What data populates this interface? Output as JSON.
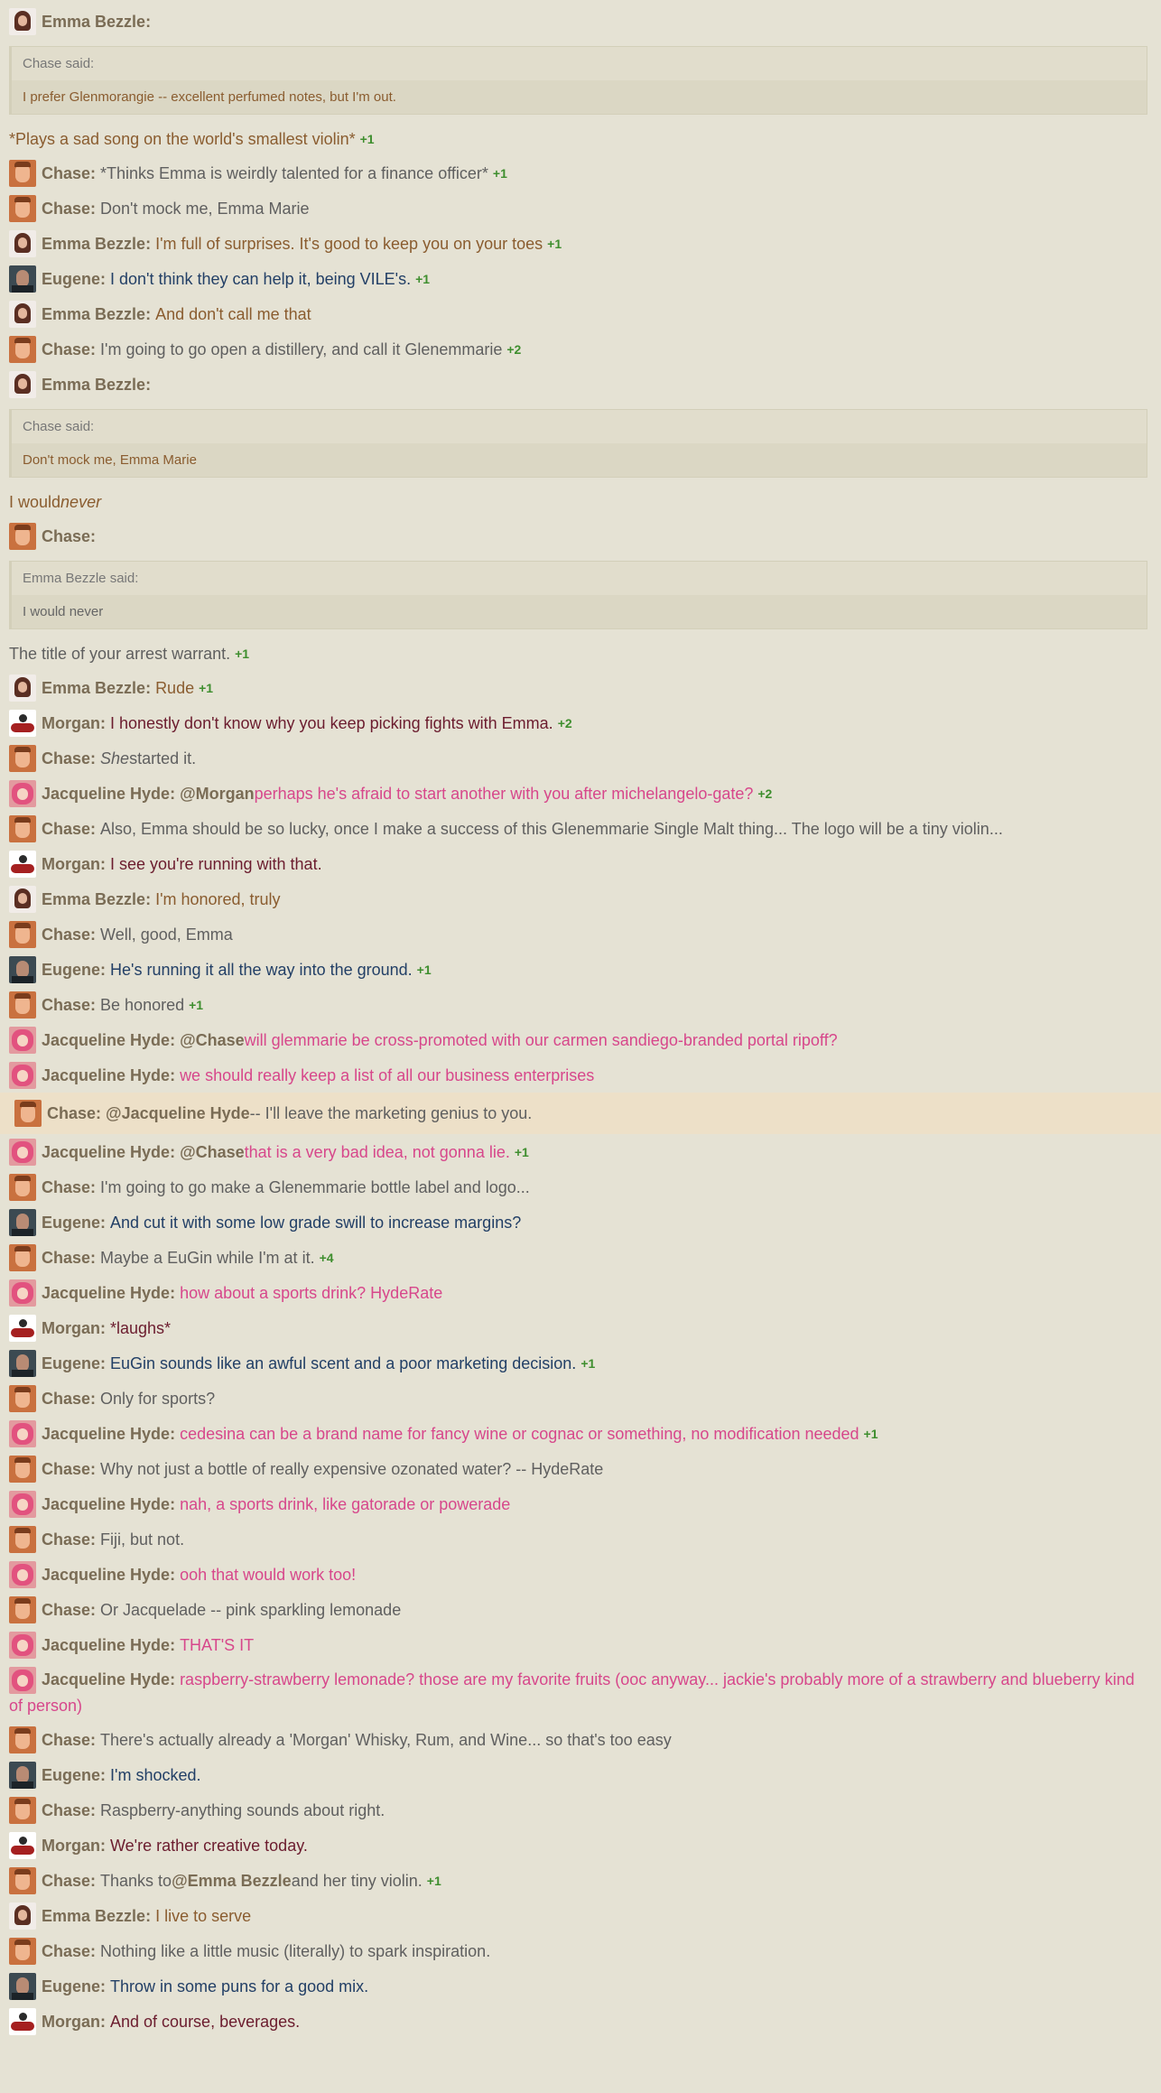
{
  "plus_prefix": "+",
  "messages": [
    {
      "kind": "msg",
      "author": "Emma Bezzle",
      "avatar": "emma",
      "parts": [],
      "plus": null,
      "quote": {
        "head": "Chase said:",
        "body": "I prefer Glenmorangie -- excellent perfumed notes, but I'm out."
      },
      "after": [
        {
          "t": "*Plays a sad song on the world's smallest violin*",
          "s": "emma"
        }
      ],
      "after_plus": "1"
    },
    {
      "kind": "msg",
      "author": "Chase",
      "avatar": "chase",
      "parts": [
        {
          "t": "*Thinks Emma is weirdly talented for a finance officer*",
          "s": "chase"
        }
      ],
      "plus": "1"
    },
    {
      "kind": "msg",
      "author": "Chase",
      "avatar": "chase",
      "parts": [
        {
          "t": "Don't mock me, Emma Marie",
          "s": "chase"
        }
      ],
      "plus": null
    },
    {
      "kind": "msg",
      "author": "Emma Bezzle",
      "avatar": "emma",
      "parts": [
        {
          "t": "I'm full of surprises. It's good to keep you on your toes",
          "s": "emma"
        }
      ],
      "plus": "1"
    },
    {
      "kind": "msg",
      "author": "Eugene",
      "avatar": "eugene",
      "parts": [
        {
          "t": "I don't think they can help it, being VILE's.",
          "s": "eugene"
        }
      ],
      "plus": "1"
    },
    {
      "kind": "msg",
      "author": "Emma Bezzle",
      "avatar": "emma",
      "parts": [
        {
          "t": "And don't call me that",
          "s": "emma"
        }
      ],
      "plus": null
    },
    {
      "kind": "msg",
      "author": "Chase",
      "avatar": "chase",
      "parts": [
        {
          "t": "I'm going to go open a distillery, and call it Glenemmarie",
          "s": "chase"
        }
      ],
      "plus": "2"
    },
    {
      "kind": "msg",
      "author": "Emma Bezzle",
      "avatar": "emma",
      "parts": [],
      "plus": null,
      "quote": {
        "head": "Chase said:",
        "body": "Don't mock me, Emma Marie"
      },
      "after": [
        {
          "t": "I would ",
          "s": "emma"
        },
        {
          "t": "never",
          "s": "emma",
          "i": true
        }
      ],
      "after_plus": null
    },
    {
      "kind": "msg",
      "author": "Chase",
      "avatar": "chase",
      "parts": [],
      "plus": null,
      "quote": {
        "head": "Emma Bezzle said:",
        "body": "I would never"
      },
      "after": [
        {
          "t": "The title of your arrest warrant.",
          "s": "chase"
        }
      ],
      "after_plus": "1"
    },
    {
      "kind": "msg",
      "author": "Emma Bezzle",
      "avatar": "emma",
      "parts": [
        {
          "t": "Rude",
          "s": "emma"
        }
      ],
      "plus": "1"
    },
    {
      "kind": "msg",
      "author": "Morgan",
      "avatar": "morgan",
      "parts": [
        {
          "t": "I honestly don't know why you keep picking fights with Emma.",
          "s": "morgan"
        }
      ],
      "plus": "2"
    },
    {
      "kind": "msg",
      "author": "Chase",
      "avatar": "chase",
      "parts": [
        {
          "t": "She",
          "s": "chase",
          "i": true
        },
        {
          "t": " started it.",
          "s": "chase"
        }
      ],
      "plus": null
    },
    {
      "kind": "msg",
      "author": "Jacqueline Hyde",
      "avatar": "jackie",
      "parts": [
        {
          "t": "@Morgan",
          "s": "mention"
        },
        {
          "t": " perhaps he's afraid to start another with you after michelangelo-gate?",
          "s": "jackie"
        }
      ],
      "plus": "2"
    },
    {
      "kind": "msg",
      "author": "Chase",
      "avatar": "chase",
      "parts": [
        {
          "t": "Also, Emma should be so lucky, once I make a success of this Glenemmarie Single Malt thing... The logo will be a tiny violin...",
          "s": "chase"
        }
      ],
      "plus": null
    },
    {
      "kind": "msg",
      "author": "Morgan",
      "avatar": "morgan",
      "parts": [
        {
          "t": "I see you're running with that.",
          "s": "morgan"
        }
      ],
      "plus": null
    },
    {
      "kind": "msg",
      "author": "Emma Bezzle",
      "avatar": "emma",
      "parts": [
        {
          "t": "I'm honored, truly",
          "s": "emma"
        }
      ],
      "plus": null
    },
    {
      "kind": "msg",
      "author": "Chase",
      "avatar": "chase",
      "parts": [
        {
          "t": "Well, good, Emma",
          "s": "chase"
        }
      ],
      "plus": null
    },
    {
      "kind": "msg",
      "author": "Eugene",
      "avatar": "eugene",
      "parts": [
        {
          "t": "He's running it all the way into the ground.",
          "s": "eugene"
        }
      ],
      "plus": "1"
    },
    {
      "kind": "msg",
      "author": "Chase",
      "avatar": "chase",
      "parts": [
        {
          "t": "Be honored",
          "s": "chase"
        }
      ],
      "plus": "1"
    },
    {
      "kind": "msg",
      "author": "Jacqueline Hyde",
      "avatar": "jackie",
      "parts": [
        {
          "t": "@Chase",
          "s": "mention"
        },
        {
          "t": " will glemmarie be cross-promoted with our carmen sandiego-branded portal ripoff?",
          "s": "jackie"
        }
      ],
      "plus": null
    },
    {
      "kind": "msg",
      "author": "Jacqueline Hyde",
      "avatar": "jackie",
      "parts": [
        {
          "t": "we should really keep a list of all our business enterprises",
          "s": "jackie"
        }
      ],
      "plus": null
    },
    {
      "kind": "msg",
      "highlight": true,
      "author": "Chase",
      "avatar": "chase",
      "parts": [
        {
          "t": "@Jacqueline Hyde",
          "s": "mention"
        },
        {
          "t": " -- I'll leave the marketing genius to you.",
          "s": "chase"
        }
      ],
      "plus": null
    },
    {
      "kind": "msg",
      "author": "Jacqueline Hyde",
      "avatar": "jackie",
      "parts": [
        {
          "t": "@Chase",
          "s": "mention"
        },
        {
          "t": " that is a very bad idea, not gonna lie.",
          "s": "jackie"
        }
      ],
      "plus": "1"
    },
    {
      "kind": "msg",
      "author": "Chase",
      "avatar": "chase",
      "parts": [
        {
          "t": "I'm going to go make a Glenemmarie bottle label and logo...",
          "s": "chase"
        }
      ],
      "plus": null
    },
    {
      "kind": "msg",
      "author": "Eugene",
      "avatar": "eugene",
      "parts": [
        {
          "t": "And cut it with some low grade swill to increase margins?",
          "s": "eugene"
        }
      ],
      "plus": null
    },
    {
      "kind": "msg",
      "author": "Chase",
      "avatar": "chase",
      "parts": [
        {
          "t": "Maybe a EuGin while I'm at it.",
          "s": "chase"
        }
      ],
      "plus": "4"
    },
    {
      "kind": "msg",
      "author": "Jacqueline Hyde",
      "avatar": "jackie",
      "parts": [
        {
          "t": "how about a sports drink? HydeRate",
          "s": "jackie"
        }
      ],
      "plus": null
    },
    {
      "kind": "msg",
      "author": "Morgan",
      "avatar": "morgan",
      "parts": [
        {
          "t": "*laughs*",
          "s": "morgan"
        }
      ],
      "plus": null
    },
    {
      "kind": "msg",
      "author": "Eugene",
      "avatar": "eugene",
      "parts": [
        {
          "t": "EuGin sounds like an awful scent and a poor marketing decision.",
          "s": "eugene"
        }
      ],
      "plus": "1"
    },
    {
      "kind": "msg",
      "author": "Chase",
      "avatar": "chase",
      "parts": [
        {
          "t": "Only for sports?",
          "s": "chase"
        }
      ],
      "plus": null
    },
    {
      "kind": "msg",
      "author": "Jacqueline Hyde",
      "avatar": "jackie",
      "parts": [
        {
          "t": "cedesina can be a brand name for fancy wine or cognac or something, no modification needed",
          "s": "jackie"
        }
      ],
      "plus": "1"
    },
    {
      "kind": "msg",
      "author": "Chase",
      "avatar": "chase",
      "parts": [
        {
          "t": "Why not just a bottle of really expensive ozonated water? -- HydeRate",
          "s": "chase"
        }
      ],
      "plus": null
    },
    {
      "kind": "msg",
      "author": "Jacqueline Hyde",
      "avatar": "jackie",
      "parts": [
        {
          "t": "nah, a sports drink, like gatorade or powerade",
          "s": "jackie"
        }
      ],
      "plus": null
    },
    {
      "kind": "msg",
      "author": "Chase",
      "avatar": "chase",
      "parts": [
        {
          "t": "Fiji, but not.",
          "s": "chase"
        }
      ],
      "plus": null
    },
    {
      "kind": "msg",
      "author": "Jacqueline Hyde",
      "avatar": "jackie",
      "parts": [
        {
          "t": "ooh that would work too!",
          "s": "jackie"
        }
      ],
      "plus": null
    },
    {
      "kind": "msg",
      "author": "Chase",
      "avatar": "chase",
      "parts": [
        {
          "t": "Or Jacquelade -- pink sparkling lemonade",
          "s": "chase"
        }
      ],
      "plus": null
    },
    {
      "kind": "msg",
      "author": "Jacqueline Hyde",
      "avatar": "jackie",
      "parts": [
        {
          "t": "THAT'S IT",
          "s": "jackie"
        }
      ],
      "plus": null
    },
    {
      "kind": "msg",
      "wrap": true,
      "author": "Jacqueline Hyde",
      "avatar": "jackie",
      "parts": [
        {
          "t": "raspberry-strawberry lemonade? those are my favorite fruits (ooc anyway... jackie's probably more of a strawberry and blueberry kind of person)",
          "s": "jackie"
        }
      ],
      "plus": null
    },
    {
      "kind": "msg",
      "author": "Chase",
      "avatar": "chase",
      "parts": [
        {
          "t": "There's actually already a 'Morgan' Whisky, Rum, and Wine... so that's too easy",
          "s": "chase"
        }
      ],
      "plus": null
    },
    {
      "kind": "msg",
      "author": "Eugene",
      "avatar": "eugene",
      "parts": [
        {
          "t": "I'm shocked.",
          "s": "eugene"
        }
      ],
      "plus": null
    },
    {
      "kind": "msg",
      "author": "Chase",
      "avatar": "chase",
      "parts": [
        {
          "t": "Raspberry-anything sounds about right.",
          "s": "chase"
        }
      ],
      "plus": null
    },
    {
      "kind": "msg",
      "author": "Morgan",
      "avatar": "morgan",
      "parts": [
        {
          "t": "We're rather creative today.",
          "s": "morgan"
        }
      ],
      "plus": null
    },
    {
      "kind": "msg",
      "author": "Chase",
      "avatar": "chase",
      "parts": [
        {
          "t": "Thanks to ",
          "s": "chase"
        },
        {
          "t": "@Emma Bezzle",
          "s": "mention"
        },
        {
          "t": " and her tiny violin.",
          "s": "chase"
        }
      ],
      "plus": "1"
    },
    {
      "kind": "msg",
      "author": "Emma Bezzle",
      "avatar": "emma",
      "parts": [
        {
          "t": "I live to serve",
          "s": "emma"
        }
      ],
      "plus": null
    },
    {
      "kind": "msg",
      "author": "Chase",
      "avatar": "chase",
      "parts": [
        {
          "t": "Nothing like a little music (literally) to spark inspiration.",
          "s": "chase"
        }
      ],
      "plus": null
    },
    {
      "kind": "msg",
      "author": "Eugene",
      "avatar": "eugene",
      "parts": [
        {
          "t": "Throw in some puns for a good mix.",
          "s": "eugene"
        }
      ],
      "plus": null
    },
    {
      "kind": "msg",
      "author": "Morgan",
      "avatar": "morgan",
      "parts": [
        {
          "t": "And of course, beverages.",
          "s": "morgan"
        }
      ],
      "plus": null
    }
  ]
}
